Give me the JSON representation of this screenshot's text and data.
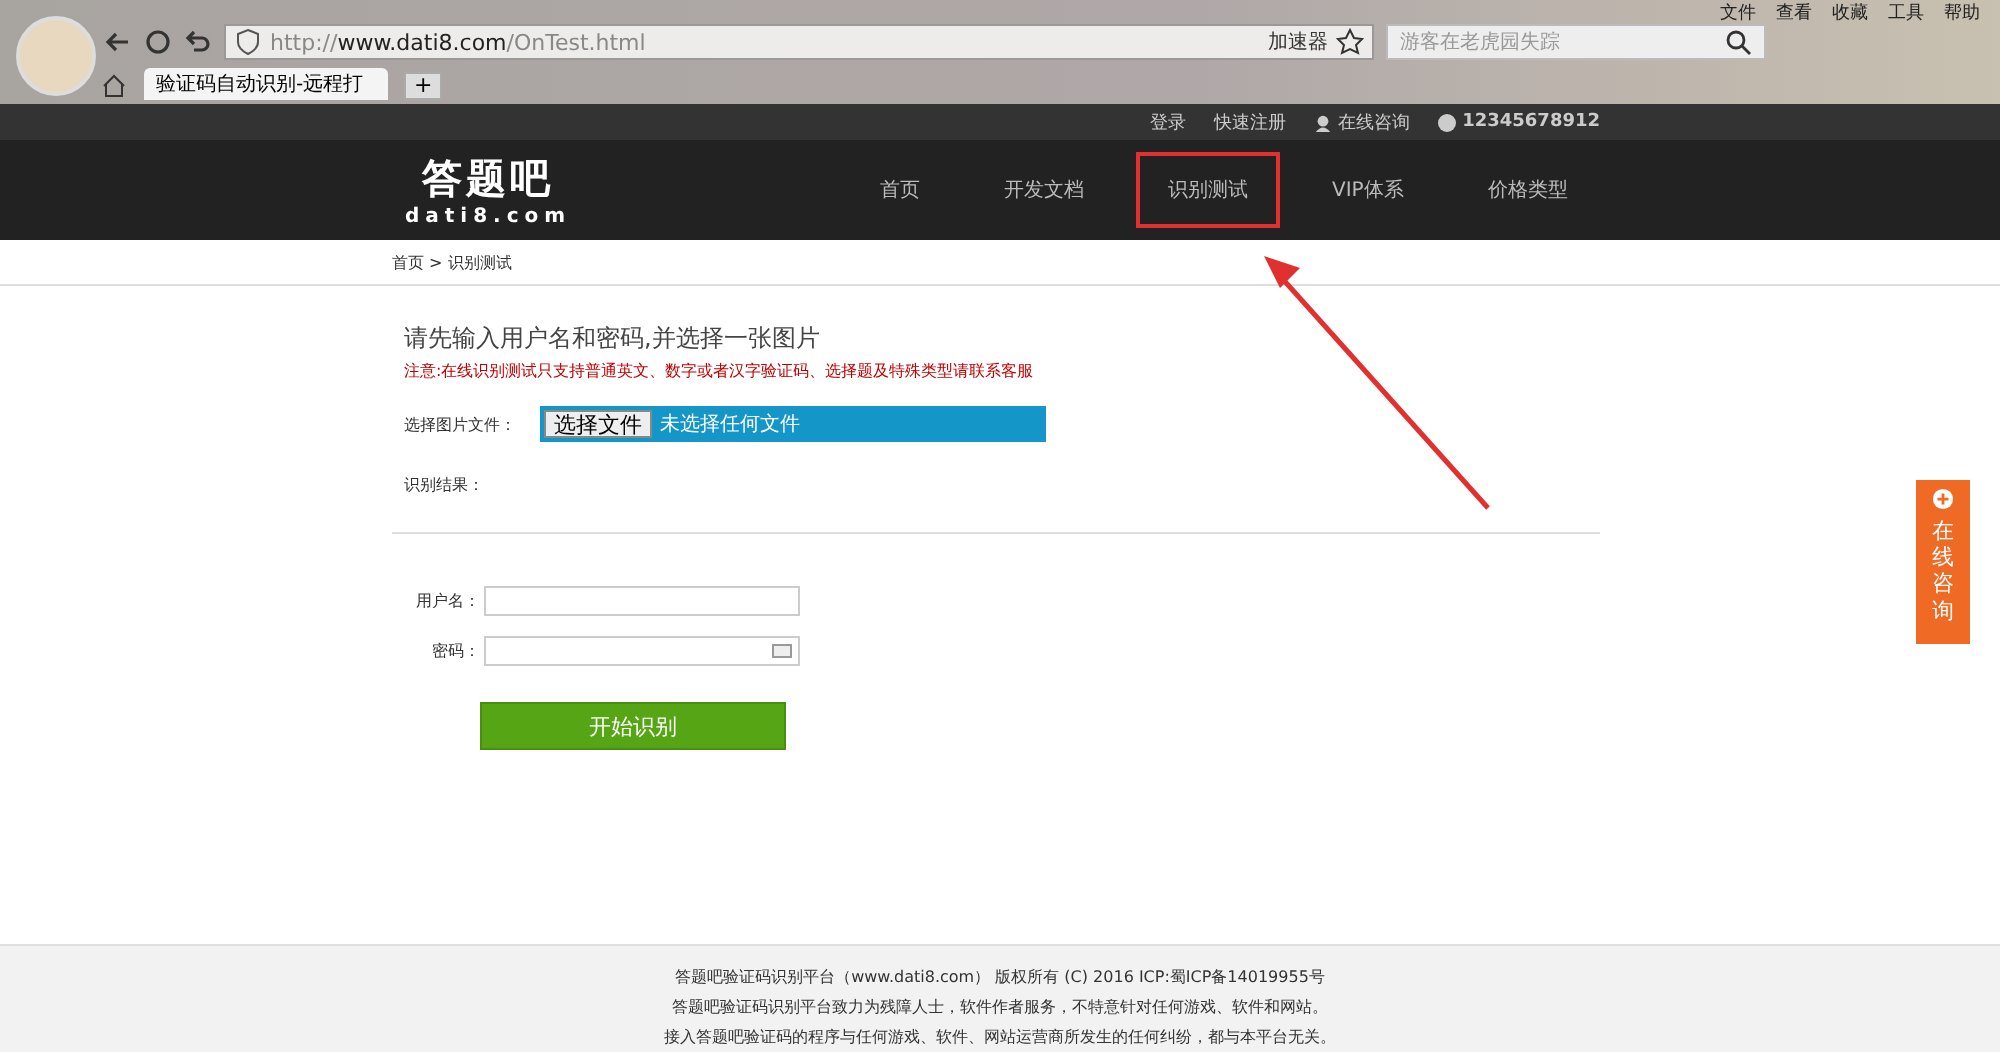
{
  "browser": {
    "url_host": "http://www.dati8.com",
    "url_path": "/OnTest.html",
    "accelerator": "加速器",
    "search_placeholder": "游客在老虎园失踪",
    "menu": [
      "文件",
      "查看",
      "收藏",
      "工具",
      "帮助"
    ],
    "tab_title": "验证码自动识别-远程打",
    "new_tab": "+"
  },
  "topbar": {
    "links": [
      "登录",
      "快速注册"
    ],
    "chat": "在线咨询",
    "phone": "12345678912"
  },
  "logo": {
    "name": "答题吧",
    "domain": "dati8.com"
  },
  "nav": [
    {
      "label": "首页",
      "highlighted": false
    },
    {
      "label": "开发文档",
      "highlighted": false
    },
    {
      "label": "识别测试",
      "highlighted": true
    },
    {
      "label": "VIP体系",
      "highlighted": false
    },
    {
      "label": "价格类型",
      "highlighted": false
    }
  ],
  "breadcrumb": "首页 > 识别测试",
  "form": {
    "heading": "请先输入用户名和密码,并选择一张图片",
    "notice": "注意:在线识别测试只支持普通英文、数字或者汉字验证码、选择题及特殊类型请联系客服",
    "file_label": "选择图片文件：",
    "file_button": "选择文件",
    "file_status": "未选择任何文件",
    "result_label": "识别结果：",
    "username_label": "用户名：",
    "password_label": "密码：",
    "submit": "开始识别"
  },
  "side_tab": "在线咨询",
  "footer": [
    "答题吧验证码识别平台（www.dati8.com） 版权所有 (C) 2016 ICP:蜀ICP备14019955号",
    "答题吧验证码识别平台致力为残障人士，软件作者服务，不特意针对任何游戏、软件和网站。",
    "接入答题吧验证码的程序与任何游戏、软件、网站运营商所发生的任何纠纷，都与本平台无关。"
  ]
}
